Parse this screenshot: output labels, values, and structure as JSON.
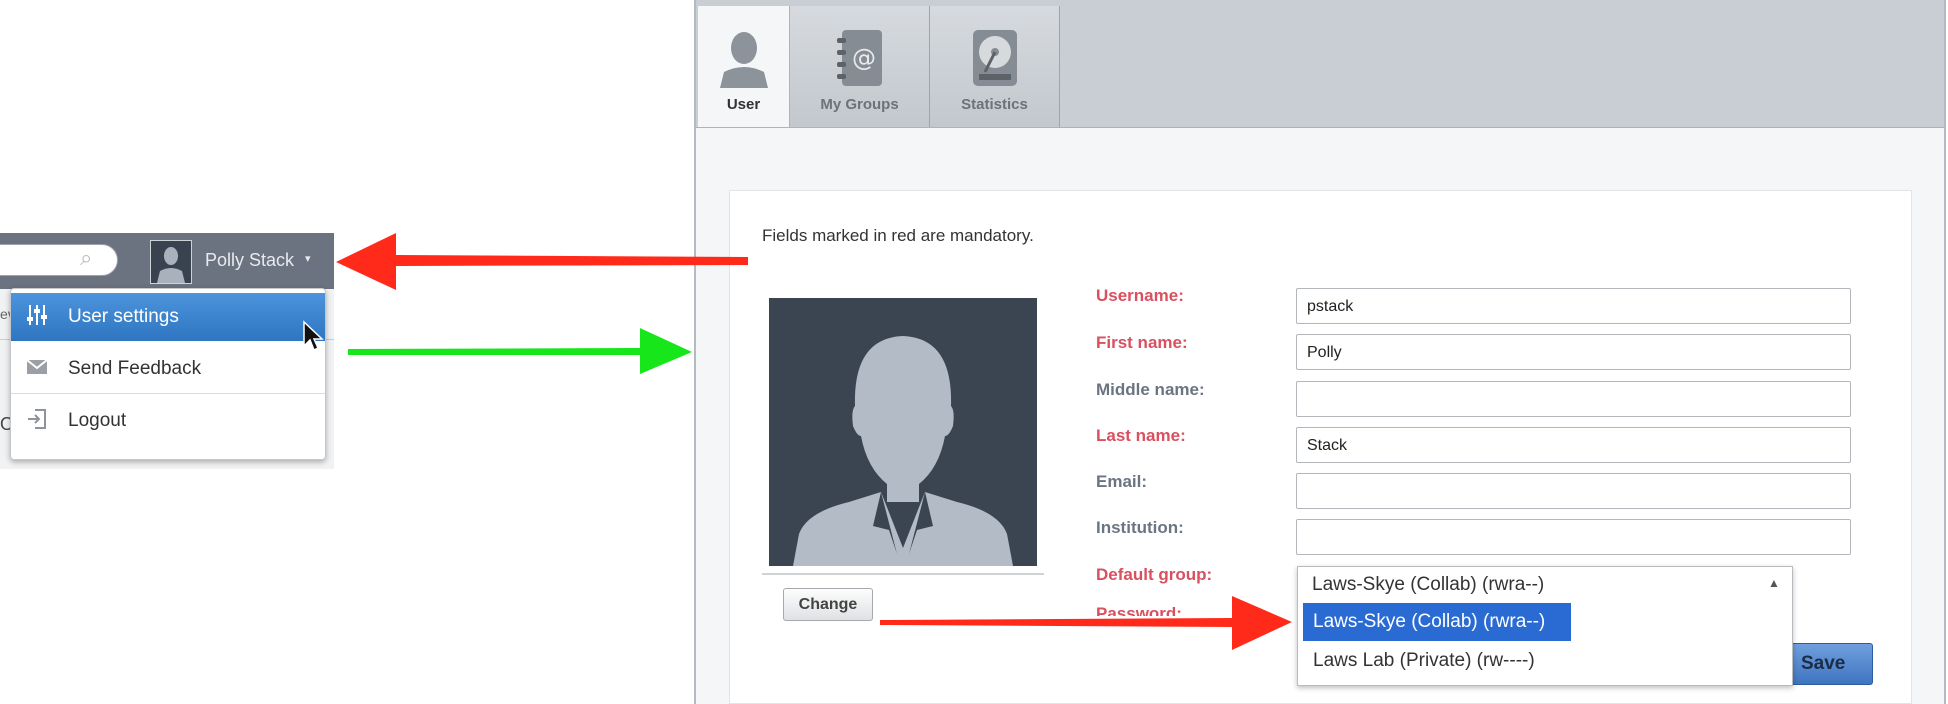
{
  "header": {
    "user_name": "Polly Stack",
    "caret": "▾",
    "search_icon": "search-icon",
    "cut_text_1": "ev",
    "cut_text_2": "O"
  },
  "user_menu": {
    "items": [
      {
        "label": "User settings",
        "icon": "sliders-icon"
      },
      {
        "label": "Send Feedback",
        "icon": "envelope-icon"
      },
      {
        "label": "Logout",
        "icon": "logout-icon"
      }
    ]
  },
  "tabs": [
    {
      "label": "User",
      "icon": "user-icon",
      "active": true
    },
    {
      "label": "My Groups",
      "icon": "address-book-icon",
      "active": false
    },
    {
      "label": "Statistics",
      "icon": "hard-drive-icon",
      "active": false
    }
  ],
  "form": {
    "notice": "Fields marked in red are mandatory.",
    "change_label": "Change",
    "save_label": "Save",
    "fields": {
      "username": {
        "label": "Username:",
        "value": "pstack"
      },
      "first_name": {
        "label": "First name:",
        "value": "Polly"
      },
      "middle_name": {
        "label": "Middle name:",
        "value": ""
      },
      "last_name": {
        "label": "Last name:",
        "value": "Stack"
      },
      "email": {
        "label": "Email:",
        "value": ""
      },
      "institution": {
        "label": "Institution:",
        "value": ""
      },
      "default_group": {
        "label": "Default group:"
      },
      "password": {
        "label": "Password:"
      }
    },
    "default_group_select": {
      "current": "Laws-Skye (Collab) (rwra--)",
      "options": [
        "Laws-Skye (Collab) (rwra--)",
        "Laws Lab (Private) (rw----)"
      ],
      "caret": "▲"
    }
  },
  "colors": {
    "arrow_red": "#ff2a1a",
    "arrow_green": "#16e61a",
    "required_label": "#d9505f",
    "selected_option": "#2a6bd3"
  }
}
